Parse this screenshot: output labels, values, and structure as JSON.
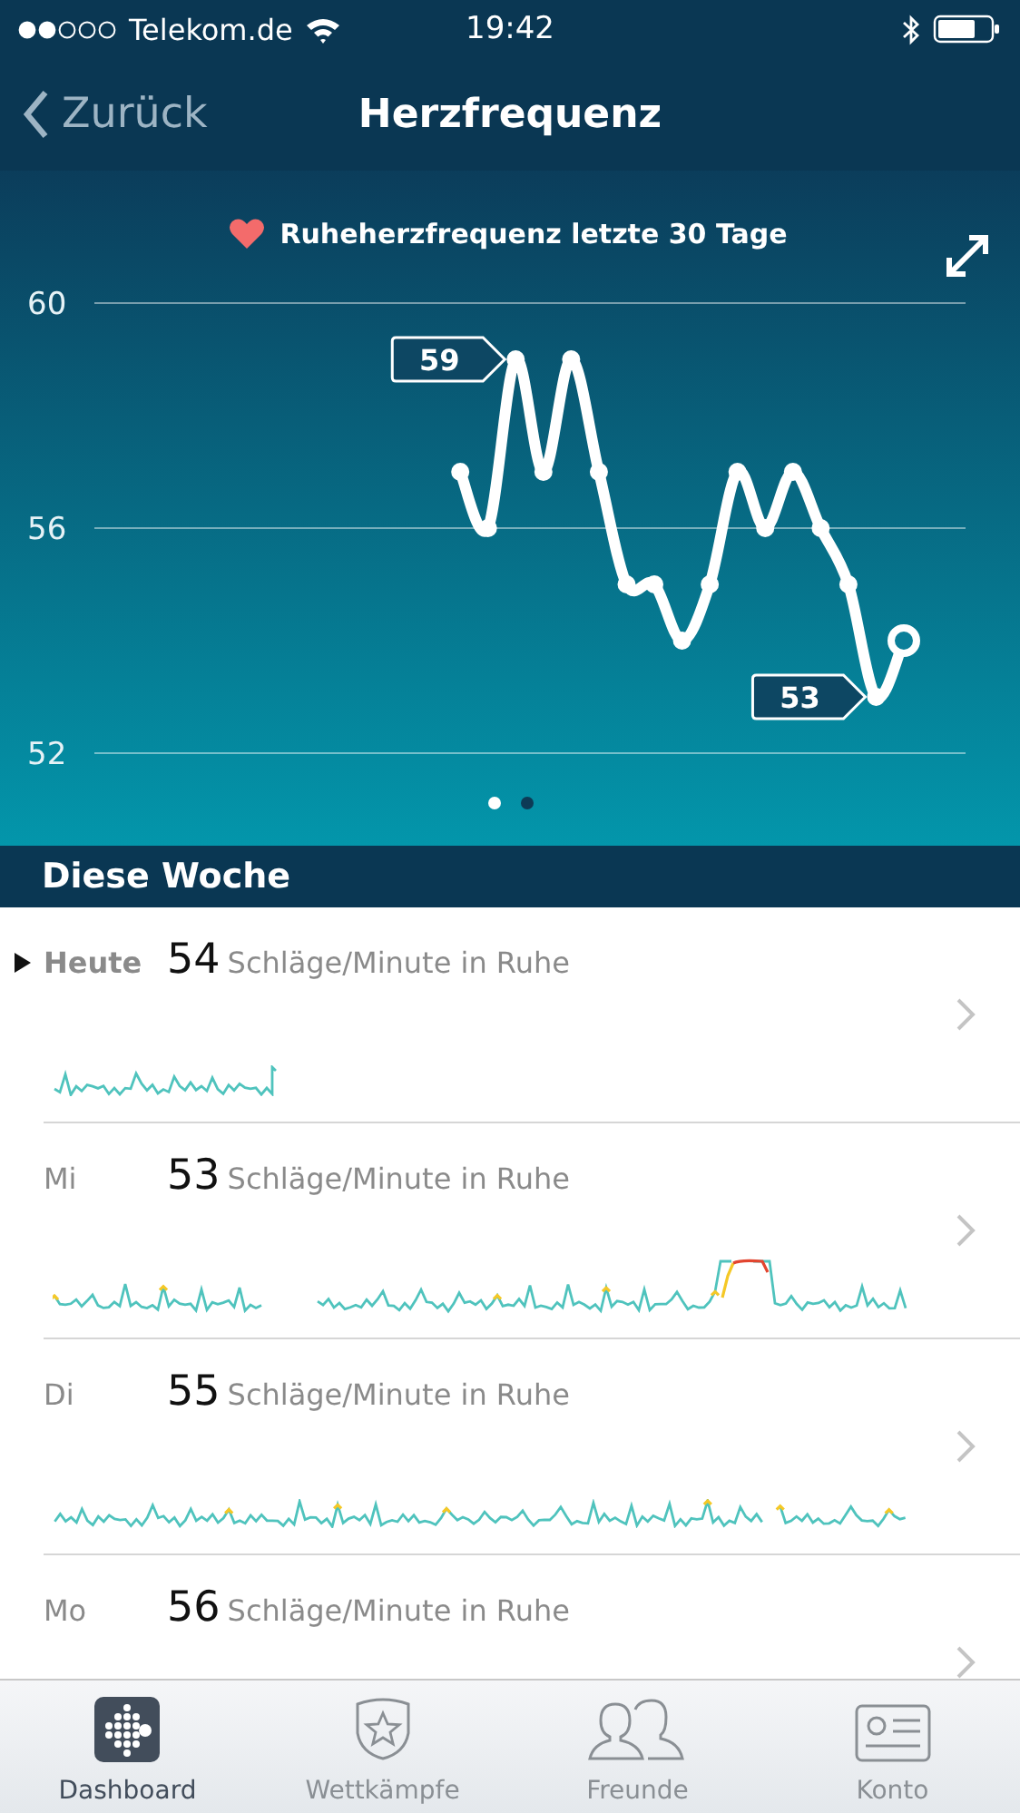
{
  "status_bar": {
    "carrier": "Telekom.de",
    "time": "19:42"
  },
  "nav": {
    "back": "Zurück",
    "title": "Herzfrequenz"
  },
  "chart": {
    "title": "Ruheherzfrequenz letzte 30 Tage",
    "chart_data": {
      "type": "line",
      "ylim": [
        52,
        60
      ],
      "yticks": [
        52,
        56,
        60
      ],
      "series": [
        {
          "color": "#ffffff",
          "marker": "circle",
          "values": [
            null,
            null,
            null,
            null,
            null,
            null,
            null,
            null,
            null,
            null,
            null,
            null,
            null,
            57,
            56,
            59,
            57,
            59,
            57,
            55,
            55,
            54,
            55,
            57,
            56,
            57,
            56,
            55,
            53,
            54
          ]
        }
      ],
      "annotations": [
        "59",
        "53"
      ]
    }
  },
  "pager": [
    {
      "selected": true
    },
    {
      "selected": false
    }
  ],
  "section": {
    "title": "Diese Woche"
  },
  "days": [
    {
      "day": "Heute",
      "value": "54",
      "unit": "Schläge/Minute in Ruhe",
      "selected": true
    },
    {
      "day": "Mi",
      "value": "53",
      "unit": "Schläge/Minute in Ruhe",
      "selected": false
    },
    {
      "day": "Di",
      "value": "55",
      "unit": "Schläge/Minute in Ruhe",
      "selected": false
    },
    {
      "day": "Mo",
      "value": "56",
      "unit": "Schläge/Minute in Ruhe",
      "selected": false
    }
  ],
  "tabs": [
    {
      "label": "Dashboard",
      "kind": "dashboard",
      "selected": true
    },
    {
      "label": "Wettkämpfe",
      "kind": "challenges",
      "selected": false
    },
    {
      "label": "Freunde",
      "kind": "friends",
      "selected": false
    },
    {
      "label": "Konto",
      "kind": "account",
      "selected": false
    }
  ]
}
